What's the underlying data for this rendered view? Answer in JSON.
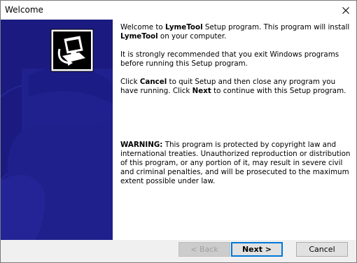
{
  "window": {
    "title": "Welcome"
  },
  "content": {
    "para1": {
      "t1": "Welcome to ",
      "b1": "LymeTool",
      "t2": " Setup program. This program will install ",
      "b2": "LymeTool",
      "t3": " on your computer."
    },
    "para2": "It is strongly recommended that you exit Windows programs before running this Setup program.",
    "para3": {
      "t1": "Click ",
      "b1": "Cancel",
      "t2": " to quit Setup and then close any program you have running. Click ",
      "b2": "Next",
      "t3": " to continue with this Setup program."
    },
    "warning": {
      "label": "WARNING:",
      "text": " This program is protected by copyright law and international treaties. Unauthorized reproduction or distribution of this program, or any portion of it, may result in severe civil and criminal penalties, and will be prosecuted to the maximum extent possible under law."
    }
  },
  "buttons": {
    "back": "< Back",
    "next": "Next >",
    "cancel": "Cancel"
  },
  "icons": {
    "close": "close-icon",
    "installer": "installer-computer-icon"
  },
  "colors": {
    "panel": "#1a1a80",
    "accent": "#0078d7"
  }
}
